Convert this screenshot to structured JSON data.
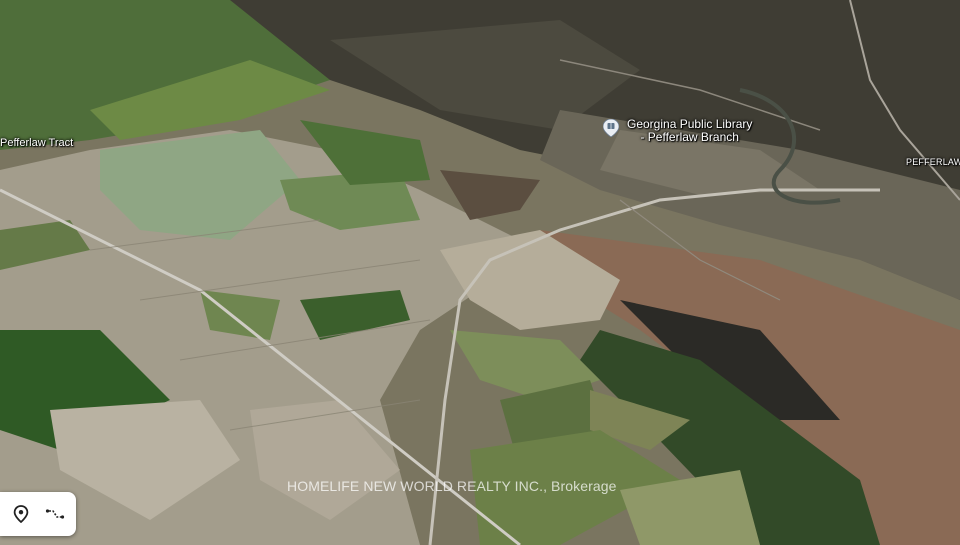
{
  "map": {
    "view": "satellite-3d",
    "labels": {
      "tract": "Pefferlaw Tract",
      "town": "PEFFERLAW"
    },
    "poi": {
      "icon": "library-pin-icon",
      "name_line1": "Georgina Public Library",
      "name_line2": "- Pefferlaw Branch"
    },
    "watermark": "HOMELIFE NEW WORLD REALTY INC., Brokerage",
    "controls": [
      {
        "icon": "location-pin-icon"
      },
      {
        "icon": "route-icon"
      }
    ]
  },
  "colors": {
    "forest": "#3d5a2a",
    "field": "#a8a090",
    "road": "#c9c6bf",
    "label": "#ffffff"
  }
}
